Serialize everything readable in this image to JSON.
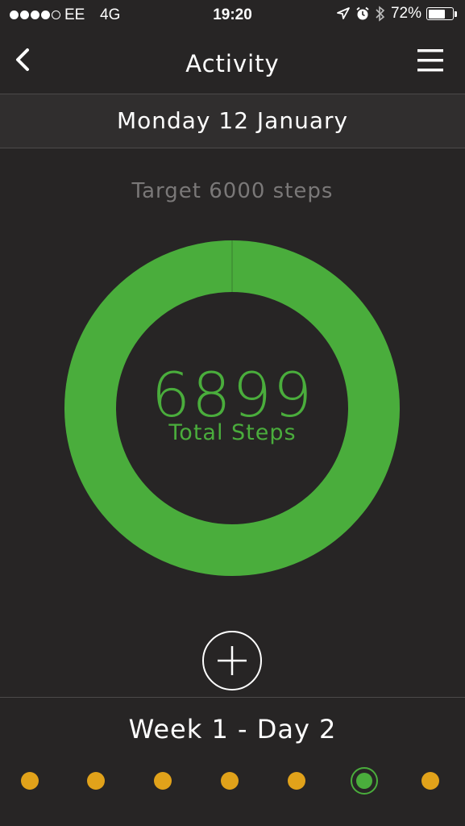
{
  "status_bar": {
    "carrier": "EE",
    "network": "4G",
    "time": "19:20",
    "battery": "72%",
    "signal_bars_filled": 4,
    "signal_bars_total": 5,
    "battery_level": 0.72
  },
  "nav": {
    "title": "Activity",
    "back_icon": "chevron-left-icon",
    "menu_icon": "hamburger-menu-icon"
  },
  "date": {
    "label": "Monday 12 January"
  },
  "activity": {
    "target_label": "Target 6000 steps",
    "target_steps": 6000,
    "steps_value": "6899",
    "steps_label": "Total Steps",
    "progress_fraction": 1.0
  },
  "week": {
    "title": "Week 1 - Day 2",
    "days": [
      {
        "status": "incomplete"
      },
      {
        "status": "incomplete"
      },
      {
        "status": "incomplete"
      },
      {
        "status": "incomplete"
      },
      {
        "status": "incomplete"
      },
      {
        "status": "current"
      },
      {
        "status": "incomplete"
      }
    ]
  },
  "colors": {
    "background": "#272525",
    "accent_green": "#4aad3c",
    "day_dot_yellow": "#e1a21a",
    "muted_text": "#7a7878"
  }
}
